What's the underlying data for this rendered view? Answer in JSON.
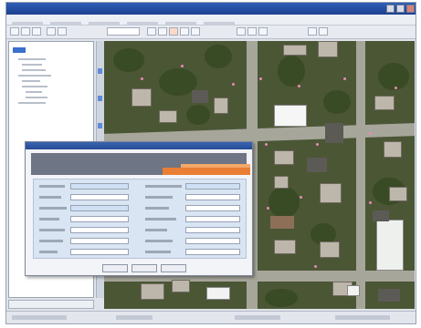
{
  "window": {
    "title": "",
    "accent_color": "#1b3f8f"
  },
  "dialog": {
    "title": "",
    "accent_color": "#ea7e35"
  },
  "icons": [
    "minimize-icon",
    "maximize-icon",
    "close-icon",
    "layer-icon"
  ]
}
